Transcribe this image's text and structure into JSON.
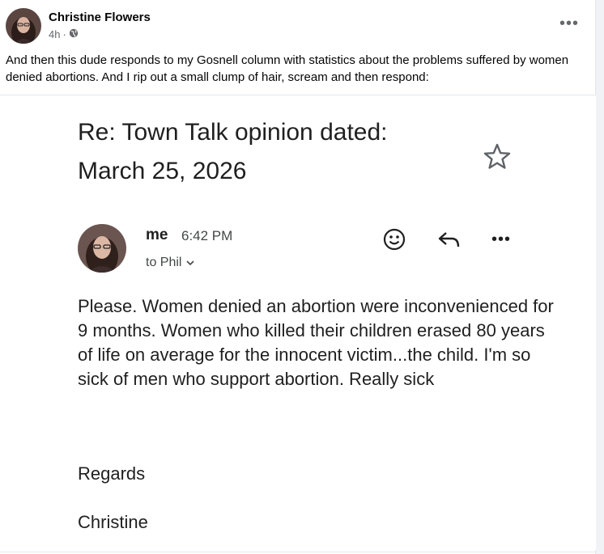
{
  "post": {
    "author": "Christine Flowers",
    "time": "4h",
    "separator": "·",
    "more_label": "•••",
    "text": "And then this dude responds to my Gosnell column with statistics about the problems suffered by women denied abortions. And I rip out a small clump of hair, scream and then respond:"
  },
  "email": {
    "subject": "Re: Town Talk opinion dated: March 25, 2026",
    "sender": "me",
    "time": "6:42 PM",
    "recipient": "to Phil",
    "body": "Please. Women denied an abortion were inconvenienced for 9 months. Women who killed their children erased 80 years of life on average for the innocent victim...the child. I'm so sick of men who support abortion. Really sick",
    "closing": "Regards",
    "signature": "Christine",
    "more_label": "•••"
  },
  "colors": {
    "facebook_text": "#050505",
    "facebook_secondary": "#65676b",
    "gmail_text": "#1f1f1f",
    "gmail_secondary": "#444746"
  }
}
